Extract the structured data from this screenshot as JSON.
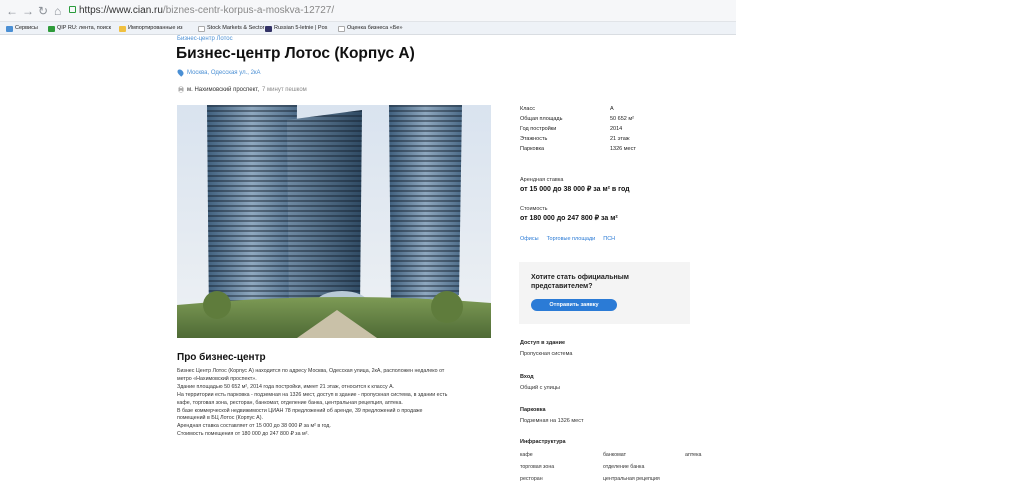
{
  "browser": {
    "url_host": "https://www.cian.ru",
    "url_path": "/biznes-centr-korpus-a-moskva-12727/",
    "bookmarks": [
      {
        "label": "Сервисы",
        "color": "#4a8fd4"
      },
      {
        "label": "QIP RU: лента, поиск",
        "color": "#2e9b3a"
      },
      {
        "label": "Импортированные из",
        "color": "#f0c040"
      },
      {
        "label": "Stock Markets & Sector",
        "color": "#cccccc"
      },
      {
        "label": "Russian 5-letnie | Pos",
        "color": "#333366"
      },
      {
        "label": "Оценка бизнеса «Бе»",
        "color": "#cccccc"
      }
    ]
  },
  "page": {
    "breadcrumb": "Бизнес-центр Лотос",
    "title": "Бизнес-центр Лотос (Корпус А)",
    "address": "Москва, Одесская ул., 2кА",
    "metro_station": "м. Нахимовский проспект,",
    "metro_walk": "7 минут пешком"
  },
  "specs": [
    {
      "label": "Класс",
      "value": "А"
    },
    {
      "label": "Общая площадь",
      "value": "50 652 м²"
    },
    {
      "label": "Год постройки",
      "value": "2014"
    },
    {
      "label": "Этажность",
      "value": "21 этаж"
    },
    {
      "label": "Парковка",
      "value": "1326 мест"
    }
  ],
  "rent": {
    "label": "Арендная ставка",
    "value": "от 15 000 до 38 000 ₽ за м² в год"
  },
  "cost": {
    "label": "Стоимость",
    "value": "от 180 000 до 247 800 ₽ за м²"
  },
  "chips": [
    "Офисы",
    "Торговые площади",
    "ПСН"
  ],
  "promo": {
    "text": "Хотите стать официальным представителем?",
    "button": "Отправить заявку"
  },
  "access": {
    "title": "Доступ в здание",
    "value": "Пропускная система"
  },
  "entrance": {
    "title": "Вход",
    "value": "Общий с улицы"
  },
  "parking": {
    "title": "Парковка",
    "value": "Подземная на 1326 мест"
  },
  "infra": {
    "title": "Инфраструктура",
    "items": [
      "кафе",
      "банкомат",
      "аптека",
      "торговая зона",
      "отделение банка",
      "ресторан",
      "центральная рецепция"
    ]
  },
  "about": {
    "title": "Про бизнес-центр",
    "lines": [
      "Бизнес Центр Лотос (Корпус А) находится по адресу Москва, Одесская улица, 2кА, расположен недалеко от",
      "метро «Нахимовский проспект».",
      "Здание площадью 50 652 м², 2014 года постройки, имеет 21 этаж, относится к классу А.",
      "На территории есть парковка - подземная на 1326 мест, доступ в здание - пропускная система, в здании есть",
      "кафе, торговая зона, ресторан, банкомат, отделение банка, центральная рецепция, аптека.",
      "В базе коммерческой недвижимости ЦИАН 78 предложений об аренде, 39 предложений о продаже",
      "помещений в БЦ Лотос (Корпус А).",
      "Арендная ставка составляет от 15 000 до 38 000 ₽ за м² в год.",
      "Стоимость помещения от 180 000 до 247 800 ₽ за м²."
    ]
  }
}
